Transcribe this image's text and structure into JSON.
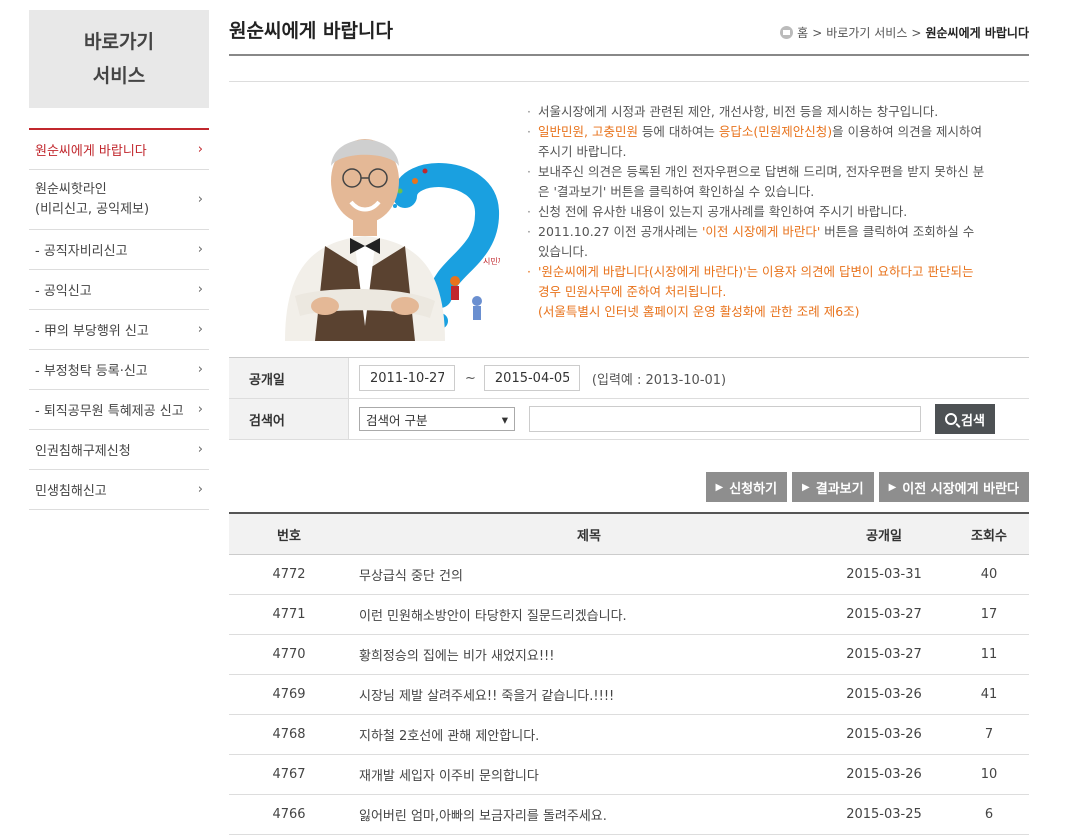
{
  "sidebar": {
    "title_line1": "바로가기",
    "title_line2": "서비스",
    "items": [
      {
        "label": "원순씨에게 바랍니다"
      },
      {
        "label_line1": "원순씨핫라인",
        "label_line2": "(비리신고, 공익제보)"
      },
      {
        "label": "- 공직자비리신고"
      },
      {
        "label": "- 공익신고"
      },
      {
        "label": "- 甲의 부당행위 신고"
      },
      {
        "label": "- 부정청탁 등록·신고"
      },
      {
        "label": "- 퇴직공무원 특혜제공 신고"
      },
      {
        "label": "인권침해구제신청"
      },
      {
        "label": "민생침해신고"
      }
    ],
    "chevron": "›"
  },
  "header": {
    "page_title": "원순씨에게 바랍니다",
    "breadcrumb": {
      "home": "홈",
      "sep": ">",
      "section": "바로가기 서비스",
      "current": "원순씨에게 바랍니다"
    }
  },
  "intro": {
    "portrait_caption": "시민께 더 물을!",
    "notes": [
      {
        "text": "서울시장에게 시정과 관련된 제안, 개선사항, 비전 등을 제시하는 창구입니다."
      },
      {
        "pre": "일반민원, 고충민원",
        "mid": " 등에 대하여는 ",
        "link": "응답소(민원제안신청)",
        "post": "을 이용하여 의견을 제시하여 주시기 바랍니다."
      },
      {
        "text": "보내주신 의견은 등록된 개인 전자우편으로 답변해 드리며, 전자우편을 받지 못하신 분은 '결과보기' 버튼을 클릭하여 확인하실 수 있습니다."
      },
      {
        "text": "신청 전에 유사한 내용이 있는지 공개사례를 확인하여 주시기 바랍니다."
      },
      {
        "pre": "2011.10.27 이전 공개사례는 ",
        "link": "'이전 시장에게 바란다'",
        "post": " 버튼을 클릭하여 조회하실 수 있습니다."
      },
      {
        "line1": "'원순씨에게 바랍니다(시장에게 바란다)'는 이용자 의견에 답변이 요하다고 판단되는 경우 민원사무에 준하여 처리됩니다.",
        "line2": "(서울특별시 인터넷 홈페이지 운영 활성화에 관한 조례 제6조)"
      }
    ]
  },
  "search": {
    "date_label": "공개일",
    "date_from": "2011-10-27",
    "tilde": "~",
    "date_to": "2015-04-05",
    "date_hint": "(입력예 : 2013-10-01)",
    "keyword_label": "검색어",
    "select_value": "검색어 구분",
    "keyword_value": "",
    "button": "검색"
  },
  "actions": [
    {
      "label": "신청하기"
    },
    {
      "label": "결과보기"
    },
    {
      "label": "이전 시장에게 바란다"
    }
  ],
  "table": {
    "headers": {
      "no": "번호",
      "title": "제목",
      "date": "공개일",
      "views": "조회수"
    },
    "rows": [
      {
        "no": "4772",
        "title": "무상급식 중단 건의",
        "date": "2015-03-31",
        "views": "40"
      },
      {
        "no": "4771",
        "title": "이런 민원해소방안이 타당한지 질문드리겠습니다.",
        "date": "2015-03-27",
        "views": "17"
      },
      {
        "no": "4770",
        "title": "황희정승의 집에는 비가 새었지요!!!",
        "date": "2015-03-27",
        "views": "11"
      },
      {
        "no": "4769",
        "title": "시장님 제발 살려주세요!! 죽을거 같습니다.!!!!",
        "date": "2015-03-26",
        "views": "41"
      },
      {
        "no": "4768",
        "title": "지하철 2호선에 관해 제안합니다.",
        "date": "2015-03-26",
        "views": "7"
      },
      {
        "no": "4767",
        "title": "재개발 세입자 이주비 문의합니다",
        "date": "2015-03-26",
        "views": "10"
      },
      {
        "no": "4766",
        "title": "잃어버린 엄마,아빠의 보금자리를 돌려주세요.",
        "date": "2015-03-25",
        "views": "6"
      }
    ]
  },
  "colors": {
    "accent_red": "#c1272d",
    "notice_orange": "#e8731c",
    "button_gray": "#8e8e8e",
    "search_button": "#4d5154"
  }
}
